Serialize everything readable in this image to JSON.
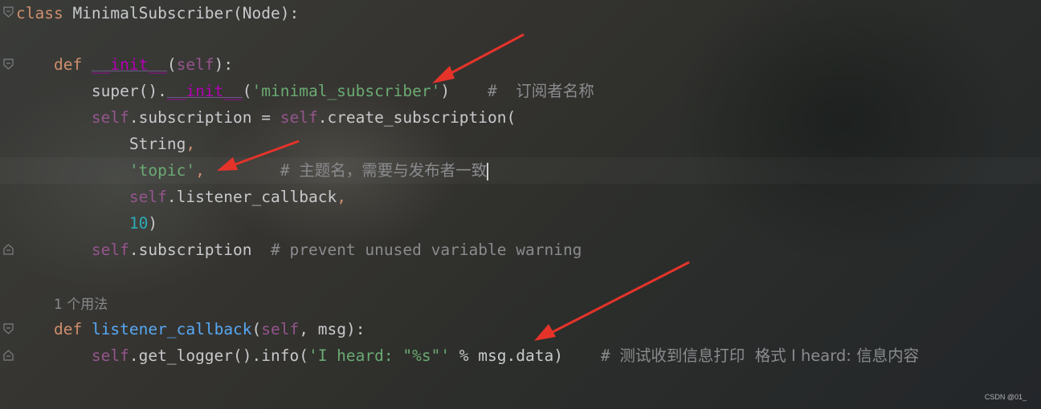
{
  "colors": {
    "keyword": "#cf8e6d",
    "self": "#94558d",
    "magic": "#b200b2",
    "string": "#6aab73",
    "number": "#2aacb8",
    "comment": "#8a8b8e",
    "function": "#56a8f5",
    "text": "#c8c9cc",
    "arrow": "#e5332a"
  },
  "code": {
    "line1": {
      "kw": "class",
      "rest": " MinimalSubscriber(Node):"
    },
    "line3": {
      "kw": "def",
      "magic": "__init__",
      "open": "(",
      "self": "self",
      "close": "):"
    },
    "line4": {
      "super": "super().",
      "magic": "__init__",
      "open": "(",
      "str": "'minimal_subscriber'",
      "close": ")",
      "comment_hash": "    #  ",
      "comment": "订阅者名称"
    },
    "line5": {
      "self1": "self",
      "mid": ".subscription = ",
      "self2": "self",
      "end": ".create_subscription("
    },
    "line6": {
      "text": "String",
      "comma": ","
    },
    "line7": {
      "str": "'topic'",
      "comma": ",",
      "comment_hash": "        # ",
      "comment": "主题名，需要与发布者一致"
    },
    "line8": {
      "self": "self",
      "rest": ".listener_callback",
      "comma": ","
    },
    "line9": {
      "num": "10",
      "close": ")"
    },
    "line10": {
      "self": "self",
      "rest": ".subscription  ",
      "comment": "# prevent unused variable warning"
    },
    "usage_hint": "1 个用法",
    "line13": {
      "kw": "def",
      "fn": "listener_callback",
      "open": "(",
      "self": "self",
      "rest": ", msg):"
    },
    "line14": {
      "self": "self",
      "rest": ".get_logger().info(",
      "str": "'I heard: \"%s\"'",
      "rest2": " % msg.data)",
      "comment_hash": "    # ",
      "comment": "测试收到信息打印  格式 I heard: 信息内容"
    }
  },
  "watermark": "CSDN @01_"
}
